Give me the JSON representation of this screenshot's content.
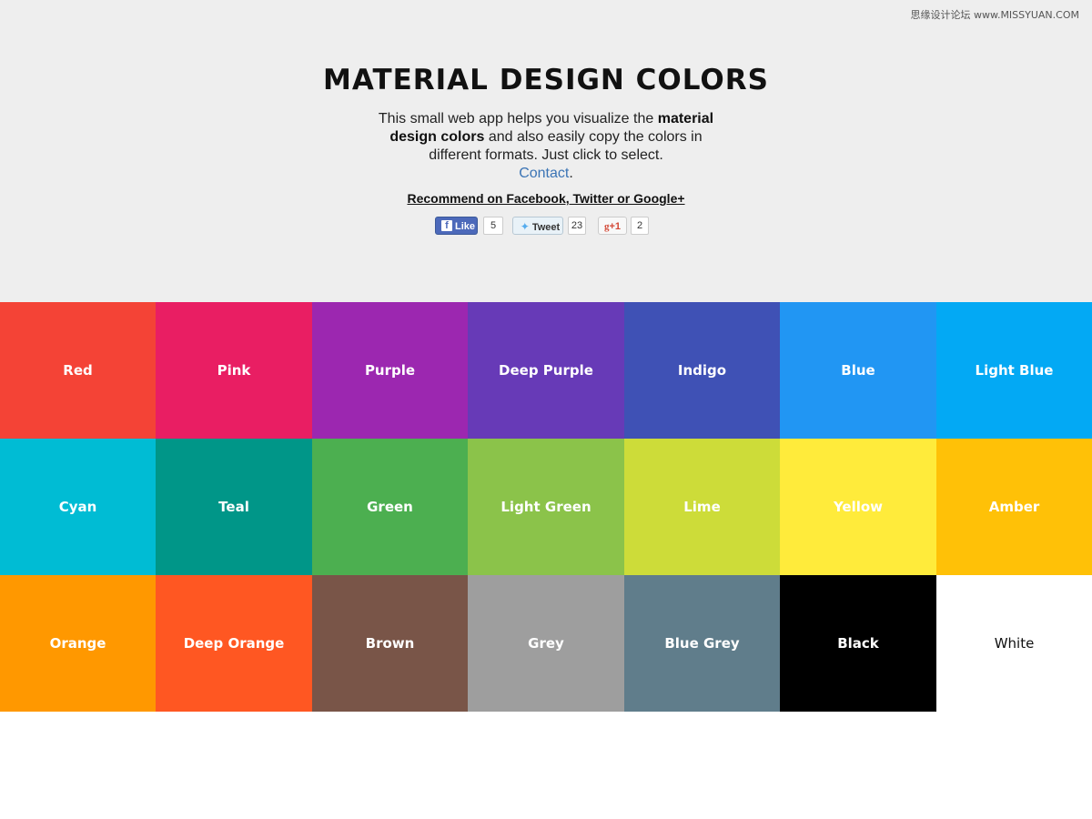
{
  "watermark": "思缘设计论坛 www.MISSYUAN.COM",
  "header": {
    "title": "MATERIAL DESIGN COLORS",
    "intro_line1": "This small web app helps you visualize the",
    "intro_bold": "material design colors",
    "intro_line2": " and also easily copy the colors in different formats. Just click to select.",
    "contact": "Contact",
    "contact_period": ".",
    "recommend": "Recommend on Facebook, Twitter or Google+"
  },
  "social": {
    "facebook_label": "Like",
    "facebook_count": "5",
    "twitter_label": "Tweet",
    "twitter_count": "23",
    "gplus_label": "+1",
    "gplus_count": "2"
  },
  "colors": [
    {
      "name": "Red",
      "hex": "#f44336"
    },
    {
      "name": "Pink",
      "hex": "#e91e63"
    },
    {
      "name": "Purple",
      "hex": "#9c27b0"
    },
    {
      "name": "Deep Purple",
      "hex": "#673ab7"
    },
    {
      "name": "Indigo",
      "hex": "#3f51b5"
    },
    {
      "name": "Blue",
      "hex": "#2196f3"
    },
    {
      "name": "Light Blue",
      "hex": "#03a9f4"
    },
    {
      "name": "Cyan",
      "hex": "#00bcd4"
    },
    {
      "name": "Teal",
      "hex": "#009688"
    },
    {
      "name": "Green",
      "hex": "#4caf50"
    },
    {
      "name": "Light Green",
      "hex": "#8bc34a"
    },
    {
      "name": "Lime",
      "hex": "#cddc39"
    },
    {
      "name": "Yellow",
      "hex": "#ffeb3b"
    },
    {
      "name": "Amber",
      "hex": "#ffc107"
    },
    {
      "name": "Orange",
      "hex": "#ff9800"
    },
    {
      "name": "Deep Orange",
      "hex": "#ff5722"
    },
    {
      "name": "Brown",
      "hex": "#795548"
    },
    {
      "name": "Grey",
      "hex": "#9e9e9e"
    },
    {
      "name": "Blue Grey",
      "hex": "#607d8b"
    },
    {
      "name": "Black",
      "hex": "#000000"
    },
    {
      "name": "White",
      "hex": "#ffffff"
    }
  ]
}
